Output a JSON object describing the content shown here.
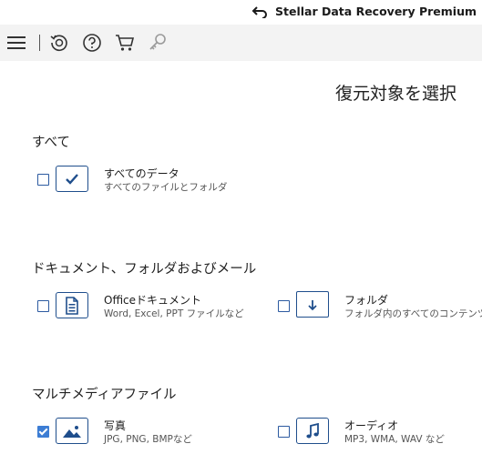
{
  "app": {
    "brand": "Stellar Data Recovery Premium"
  },
  "toolbar": {
    "items": [
      "menu-icon",
      "recover-history-icon",
      "help-icon",
      "cart-icon",
      "key-icon"
    ]
  },
  "page": {
    "title": "復元対象を選択"
  },
  "sections": {
    "all": {
      "title": "すべて",
      "items": [
        {
          "label": "すべてのデータ",
          "sub": "すべてのファイルとフォルダ",
          "checked": false,
          "icon": "check-box-icon"
        }
      ]
    },
    "docs": {
      "title": "ドキュメント、フォルダおよびメール",
      "items": [
        {
          "label": "Officeドキュメント",
          "sub": "Word, Excel, PPT ファイルなど",
          "checked": false,
          "icon": "document-icon"
        },
        {
          "label": "フォルダ",
          "sub": "フォルダ内のすべてのコンテンツ",
          "checked": false,
          "icon": "folder-icon"
        }
      ]
    },
    "media": {
      "title": "マルチメディアファイル",
      "items": [
        {
          "label": "写真",
          "sub": "JPG, PNG, BMPなど",
          "checked": true,
          "icon": "photo-icon"
        },
        {
          "label": "オーディオ",
          "sub": "MP3, WMA, WAV など",
          "checked": false,
          "icon": "audio-icon"
        }
      ]
    }
  },
  "colors": {
    "accent": "#1f4e8c",
    "checkbox_checked": "#3c7dd4",
    "toolbar_bg": "#f3f3f3"
  }
}
